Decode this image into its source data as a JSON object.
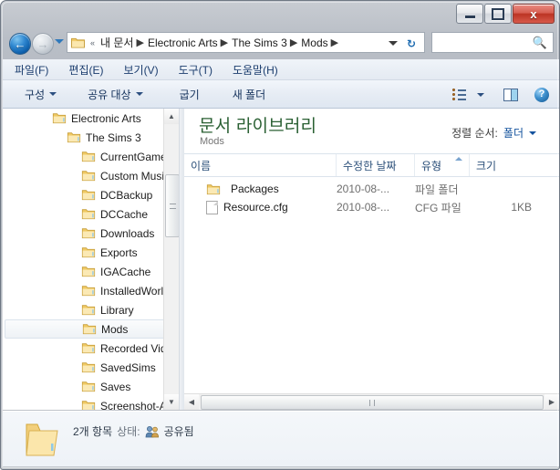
{
  "window": {
    "titlebar": {
      "minimize_label": "",
      "maximize_label": "",
      "close_label": "x"
    }
  },
  "addressbar": {
    "back_glyph": "←",
    "forward_glyph": "→",
    "overflow_chevrons": "«",
    "crumbs": [
      {
        "label": "내 문서"
      },
      {
        "label": "Electronic Arts"
      },
      {
        "label": "The Sims 3"
      },
      {
        "label": "Mods"
      }
    ],
    "separator": "▶",
    "refresh_glyph": "↻",
    "search_value": "",
    "search_placeholder": ""
  },
  "menubar": {
    "items": [
      {
        "label": "파일(F)"
      },
      {
        "label": "편집(E)"
      },
      {
        "label": "보기(V)"
      },
      {
        "label": "도구(T)"
      },
      {
        "label": "도움말(H)"
      }
    ]
  },
  "commandbar": {
    "organize_label": "구성",
    "share_label": "공유 대상",
    "burn_label": "굽기",
    "newfolder_label": "새 폴더",
    "help_glyph": "?"
  },
  "navpane": {
    "items": [
      {
        "label": "Electronic Arts",
        "indent": 1,
        "selected": false
      },
      {
        "label": "The Sims 3",
        "indent": 2,
        "selected": false
      },
      {
        "label": "CurrentGame.si",
        "indent": 3,
        "selected": false
      },
      {
        "label": "Custom Music",
        "indent": 3,
        "selected": false
      },
      {
        "label": "DCBackup",
        "indent": 3,
        "selected": false
      },
      {
        "label": "DCCache",
        "indent": 3,
        "selected": false
      },
      {
        "label": "Downloads",
        "indent": 3,
        "selected": false
      },
      {
        "label": "Exports",
        "indent": 3,
        "selected": false
      },
      {
        "label": "IGACache",
        "indent": 3,
        "selected": false
      },
      {
        "label": "InstalledWorlds",
        "indent": 3,
        "selected": false
      },
      {
        "label": "Library",
        "indent": 3,
        "selected": false
      },
      {
        "label": "Mods",
        "indent": 3,
        "selected": true
      },
      {
        "label": "Recorded Videc",
        "indent": 3,
        "selected": false
      },
      {
        "label": "SavedSims",
        "indent": 3,
        "selected": false
      },
      {
        "label": "Saves",
        "indent": 3,
        "selected": false
      },
      {
        "label": "Screenshot-All",
        "indent": 3,
        "selected": false
      }
    ],
    "scroll_up_glyph": "▲",
    "scroll_down_glyph": "▼"
  },
  "listpane": {
    "library_title": "문서 라이브러리",
    "library_subtitle": "Mods",
    "sort_label": "정렬 순서:",
    "sort_value": "폴더",
    "columns": [
      {
        "label": "이름",
        "sorted": false
      },
      {
        "label": "수정한 날짜",
        "sorted": false
      },
      {
        "label": "유형",
        "sorted": true
      },
      {
        "label": "크기",
        "sorted": false
      }
    ],
    "rows": [
      {
        "name": "Packages",
        "date": "2010-08-...",
        "type": "파일 폴더",
        "size": "",
        "icon": "folder-icon"
      },
      {
        "name": "Resource.cfg",
        "date": "2010-08-...",
        "type": "CFG 파일",
        "size": "1KB",
        "icon": "document-icon"
      }
    ],
    "scroll_left_glyph": "◀",
    "scroll_right_glyph": "▶"
  },
  "statusbar": {
    "item_count": "2개 항목",
    "state_label": "상태:",
    "shared_label": "공유됨"
  },
  "colors": {
    "library_title": "#2a6033",
    "link": "#15539e",
    "column_header": "#2b4f79",
    "menu_text": "#1b3d6e",
    "close_button": "#bc3424",
    "folder_yellow": "#f6d478"
  }
}
